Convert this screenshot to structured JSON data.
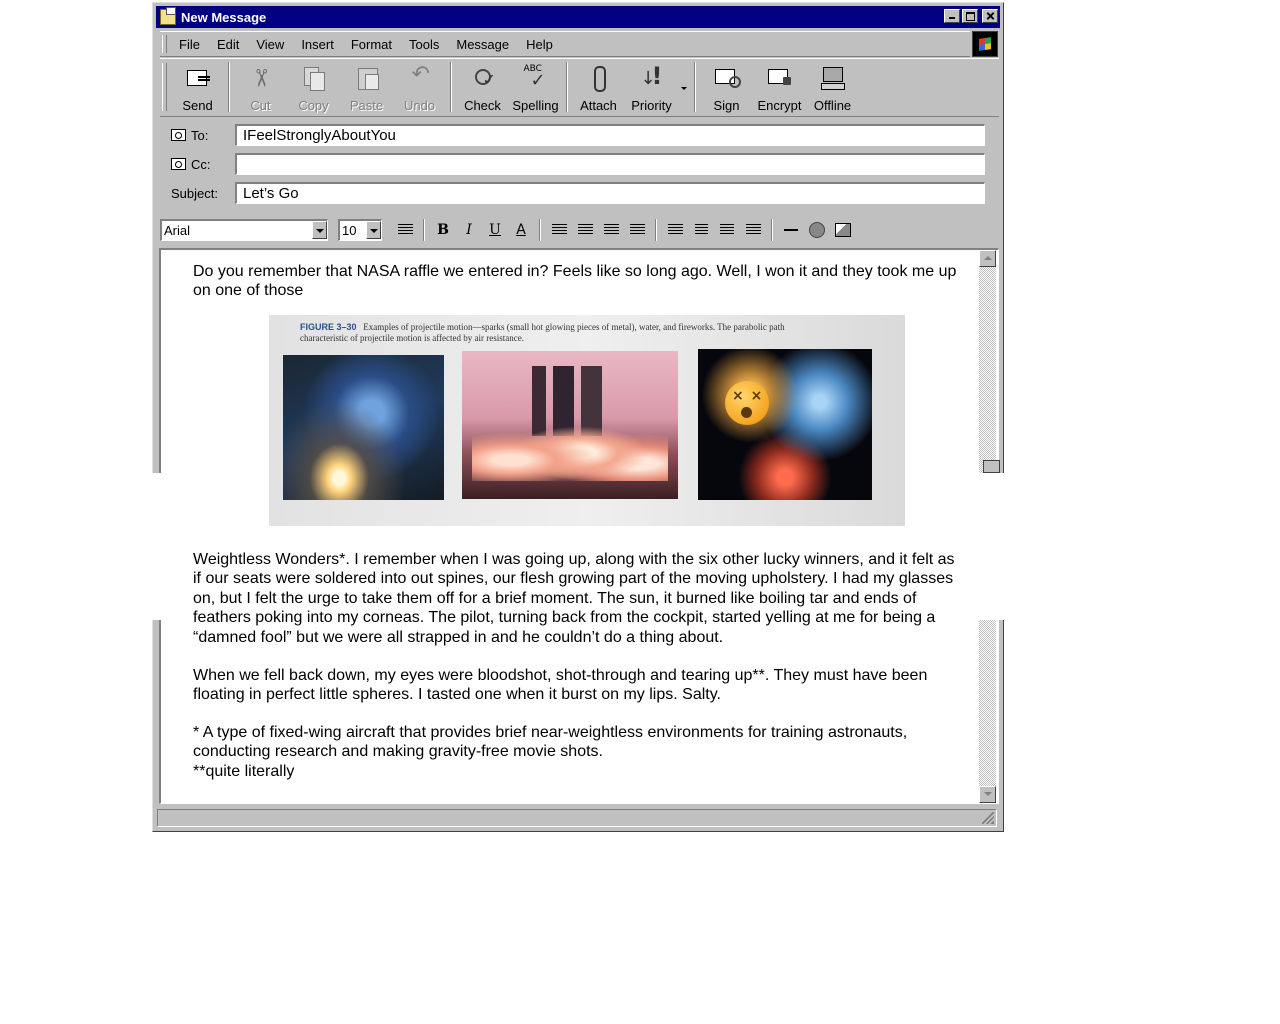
{
  "window": {
    "title": "New Message"
  },
  "menu": [
    {
      "key": "F",
      "rest": "ile"
    },
    {
      "key": "E",
      "rest": "dit"
    },
    {
      "key": "V",
      "rest": "iew"
    },
    {
      "key": "I",
      "rest": "nsert"
    },
    {
      "key": "F",
      "pre": "",
      "rest": "ormat",
      "label": "Format",
      "underline_index": 3
    },
    {
      "key": "T",
      "rest": "ools"
    },
    {
      "key": "M",
      "rest": "essage"
    },
    {
      "key": "H",
      "rest": "elp"
    }
  ],
  "menu_labels": {
    "file": "File",
    "edit": "Edit",
    "view": "View",
    "insert": "Insert",
    "format": "Format",
    "tools": "Tools",
    "message": "Message",
    "help": "Help"
  },
  "toolbar": {
    "send": "Send",
    "cut": "Cut",
    "copy": "Copy",
    "paste": "Paste",
    "undo": "Undo",
    "check": "Check",
    "spelling": "Spelling",
    "attach": "Attach",
    "priority": "Priority",
    "sign": "Sign",
    "encrypt": "Encrypt",
    "offline": "Offline"
  },
  "fields": {
    "to_label": "To:",
    "to_value": "IFeelStronglyAboutYou",
    "cc_label": "Cc:",
    "cc_value": "",
    "subject_label": "Subject:",
    "subject_value": "Let’s Go"
  },
  "format": {
    "font": "Arial",
    "size": "10",
    "bold": "B",
    "italic": "I",
    "underline": "U",
    "font_color": "A"
  },
  "message": {
    "para1": "Do you remember that NASA raffle we entered in? Feels like so long ago. Well, I won it and they took me up on one of those",
    "para2": "Weightless Wonders*. I remember when I was going up, along with the six other lucky winners, and it felt as if our seats were soldered into out spines, our flesh growing part of the moving upholstery. I had my glasses on, but I felt the urge to take them off for a brief moment. The sun, it burned like boiling tar and ends of feathers poking into my corneas. The pilot, turning back from the cockpit, started yelling at me for being a “damned fool” but we were all strapped in and he couldn’t do a thing about.",
    "para3": "When we fell back down, my eyes were bloodshot, shot-through and tearing up**. They must have been floating in perfect little spheres. I tasted one when it burst on my lips. Salty.",
    "footnote1": "* A type of fixed-wing aircraft that provides brief near-weightless environments for training astronauts, conducting research and making gravity-free movie shots.",
    "footnote2": "**quite literally"
  },
  "photo": {
    "figure_label": "FIGURE 3–30",
    "caption": "Examples of projectile motion—sparks (small hot glowing pieces of metal), water, and fireworks. The parabolic path characteristic of projectile motion is affected by air resistance."
  }
}
